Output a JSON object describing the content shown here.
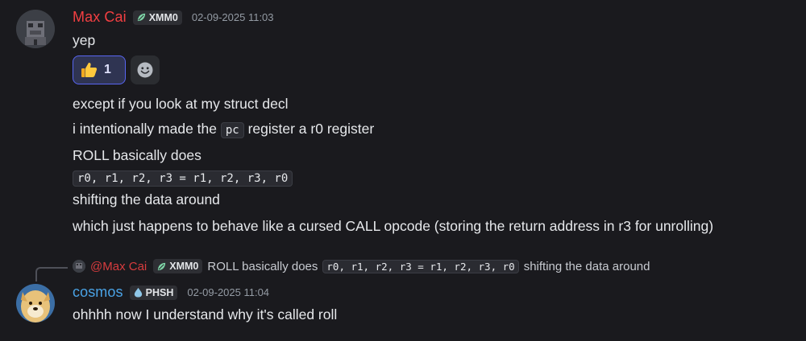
{
  "messages": [
    {
      "author": "Max Cai",
      "author_color": "#f23f42",
      "tag": "XMM0",
      "timestamp": "02-09-2025 11:03",
      "lines": [
        "yep"
      ],
      "reactions": [
        {
          "emoji": "thumbs-up",
          "count": "1"
        }
      ],
      "followups": [
        "except if you look at my struct decl",
        {
          "before": "i intentionally made the ",
          "code": "pc",
          "after": " register a r0 register"
        },
        "ROLL basically does",
        {
          "code": "r0, r1, r2, r3 = r1, r2, r3, r0"
        },
        "shifting the data around",
        "which just happens to behave like a cursed CALL opcode (storing the return address in r3 for unrolling)"
      ]
    },
    {
      "reply_to": {
        "mention": "@Max Cai",
        "tag": "XMM0",
        "text_before": "ROLL basically does",
        "code": "r0, r1, r2, r3 = r1, r2, r3, r0",
        "text_after": "shifting the data around"
      },
      "author": "cosmos",
      "author_color": "#4aa3e6",
      "tag": "PHSH",
      "timestamp": "02-09-2025 11:04",
      "lines": [
        "ohhhh now I understand why it's called roll"
      ]
    }
  ],
  "colors": {
    "background": "#1a1a1e",
    "accent": "#5865f2",
    "muted": "#949ba4"
  }
}
